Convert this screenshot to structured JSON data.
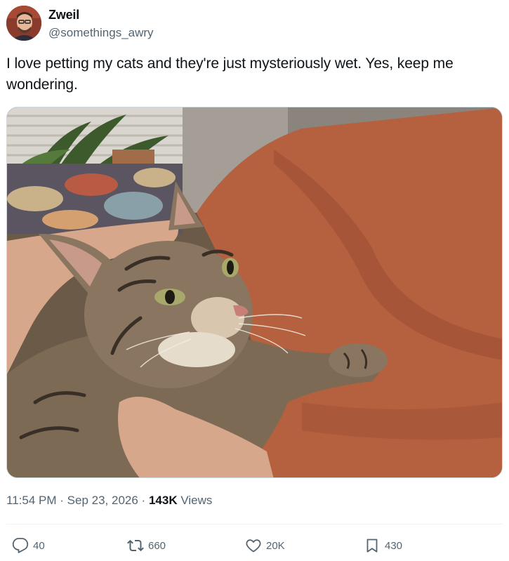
{
  "author": {
    "display_name": "Zweil",
    "handle": "@somethings_awry"
  },
  "tweet": {
    "text": "I love petting my cats and they're just mysteriously wet. Yes, keep me wondering.",
    "time": "11:54 PM",
    "separator": "·",
    "date": "Sep 23, 2026",
    "views_count": "143K",
    "views_label": "Views"
  },
  "actions": {
    "replies": "40",
    "retweets": "660",
    "likes": "20K",
    "bookmarks": "430"
  },
  "colors": {
    "text_primary": "#0f1419",
    "text_secondary": "#536471",
    "divider": "#eff3f4",
    "border": "#cfd9de"
  },
  "icons": {
    "reply": "speech-bubble-icon",
    "retweet": "retweet-arrows-icon",
    "like": "heart-icon",
    "bookmark": "bookmark-icon"
  }
}
